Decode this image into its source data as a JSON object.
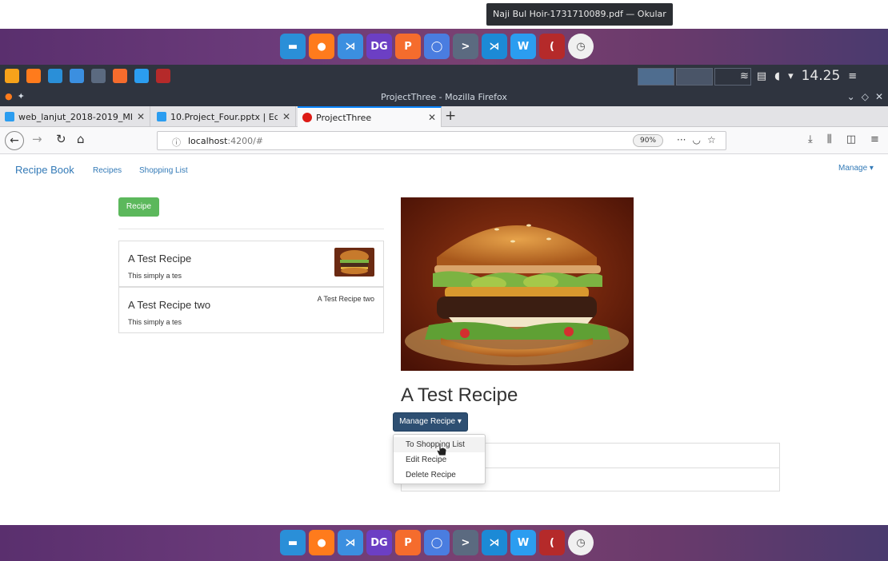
{
  "tooltip": {
    "text": "Naji Bul Hoir-1731710089.pdf — Okular"
  },
  "dock": {
    "apps": [
      {
        "name": "files",
        "color": "#2a8fd8",
        "glyph": "▬"
      },
      {
        "name": "firefox",
        "color": "#ff7b1c",
        "glyph": "●"
      },
      {
        "name": "vscode",
        "color": "#3b8fe0",
        "glyph": "⋊"
      },
      {
        "name": "datagrip",
        "color": "#6c3fc4",
        "glyph": "DG"
      },
      {
        "name": "presentation",
        "color": "#f56c2d",
        "glyph": "P"
      },
      {
        "name": "chromium",
        "color": "#4a7de0",
        "glyph": "◯"
      },
      {
        "name": "terminal",
        "color": "#5b6a80",
        "glyph": ">"
      },
      {
        "name": "vscode-insiders",
        "color": "#1c8ad6",
        "glyph": "⋊"
      },
      {
        "name": "writer",
        "color": "#2b9df0",
        "glyph": "W"
      },
      {
        "name": "okular",
        "color": "#b52a2a",
        "glyph": "("
      },
      {
        "name": "clock",
        "color": "#f0f0f0",
        "glyph": "◷"
      }
    ]
  },
  "panel": {
    "clock": "14.25",
    "icons": [
      "#f6a21a",
      "#ff7b1c",
      "#2a8fd8",
      "#3b8fe0",
      "#5b6a80",
      "#f56c2d",
      "#2b9df0",
      "#b52a2a"
    ]
  },
  "window": {
    "title": "ProjectThree - Mozilla Firefox"
  },
  "tabs": [
    {
      "title": "web_lanjut_2018-2019_MI",
      "active": false
    },
    {
      "title": "10.Project_Four.pptx | Ed",
      "active": false
    },
    {
      "title": "ProjectThree",
      "active": true
    }
  ],
  "urlbar": {
    "host": "localhost",
    "rest": ":4200/#",
    "zoom": "90%"
  },
  "app": {
    "brand": "Recipe Book",
    "nav": {
      "recipes": "Recipes",
      "shopping_list": "Shopping List"
    },
    "manage": "Manage ▾",
    "new_recipe_button": "Recipe",
    "recipes": [
      {
        "name": "A Test Recipe",
        "description": "This simply a tes",
        "image_alt": ""
      },
      {
        "name": "A Test Recipe two",
        "description": "This simply a tes",
        "image_alt": "A Test Recipe two"
      }
    ],
    "detail": {
      "title": "A Test Recipe",
      "manage_button": "Manage Recipe ▾",
      "dropdown": [
        "To Shopping List",
        "Edit Recipe",
        "Delete Recipe"
      ]
    }
  }
}
